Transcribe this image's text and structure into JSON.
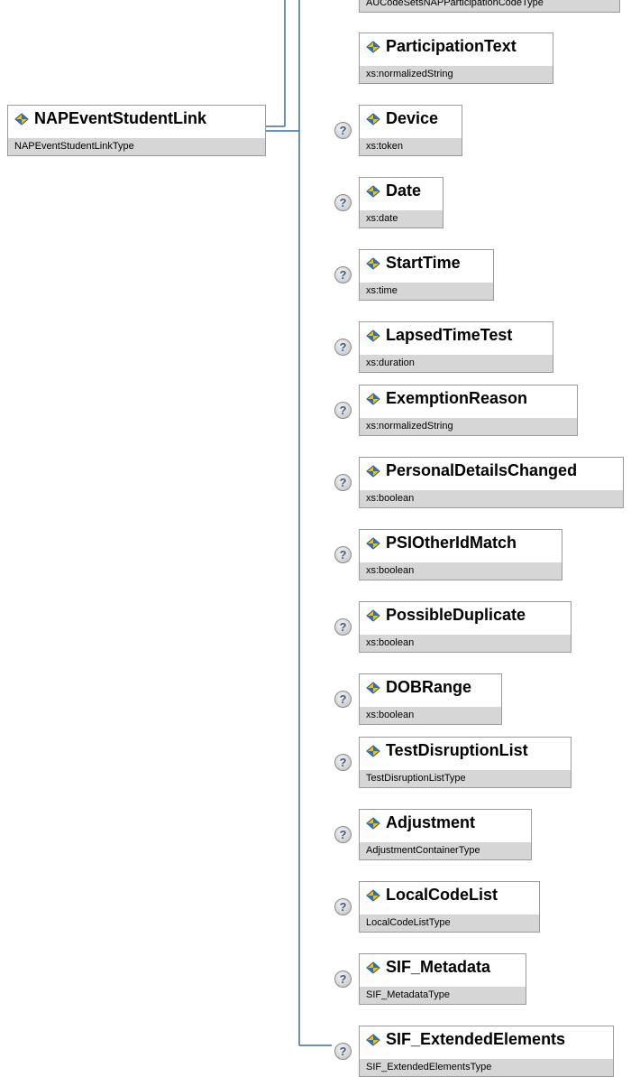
{
  "top_partial_type": "AUCodeSetsNAPParticipationCodeType",
  "root": {
    "name": "NAPEventStudentLink",
    "type": "NAPEventStudentLinkType"
  },
  "optional_marker": "?",
  "elements": [
    {
      "name": "ParticipationText",
      "type": "xs:normalizedString",
      "optional": false
    },
    {
      "name": "Device",
      "type": "xs:token",
      "optional": true
    },
    {
      "name": "Date",
      "type": "xs:date",
      "optional": true
    },
    {
      "name": "StartTime",
      "type": "xs:time",
      "optional": true
    },
    {
      "name": "LapsedTimeTest",
      "type": "xs:duration",
      "optional": true
    },
    {
      "name": "ExemptionReason",
      "type": "xs:normalizedString",
      "optional": true
    },
    {
      "name": "PersonalDetailsChanged",
      "type": "xs:boolean",
      "optional": true
    },
    {
      "name": "PSIOtherIdMatch",
      "type": "xs:boolean",
      "optional": true
    },
    {
      "name": "PossibleDuplicate",
      "type": "xs:boolean",
      "optional": true
    },
    {
      "name": "DOBRange",
      "type": "xs:boolean",
      "optional": true
    },
    {
      "name": "TestDisruptionList",
      "type": "TestDisruptionListType",
      "optional": true
    },
    {
      "name": "Adjustment",
      "type": "AdjustmentContainerType",
      "optional": true
    },
    {
      "name": "LocalCodeList",
      "type": "LocalCodeListType",
      "optional": true
    },
    {
      "name": "SIF_Metadata",
      "type": "SIF_MetadataType",
      "optional": true
    },
    {
      "name": "SIF_ExtendedElements",
      "type": "SIF_ExtendedElementsType",
      "optional": true
    }
  ],
  "colors": {
    "line": "#3a6ea5",
    "border": "#9a9a9a",
    "type_band": "#d6d6d6",
    "icon_blue": "#2f6fb7",
    "icon_yellow": "#f2c200"
  }
}
